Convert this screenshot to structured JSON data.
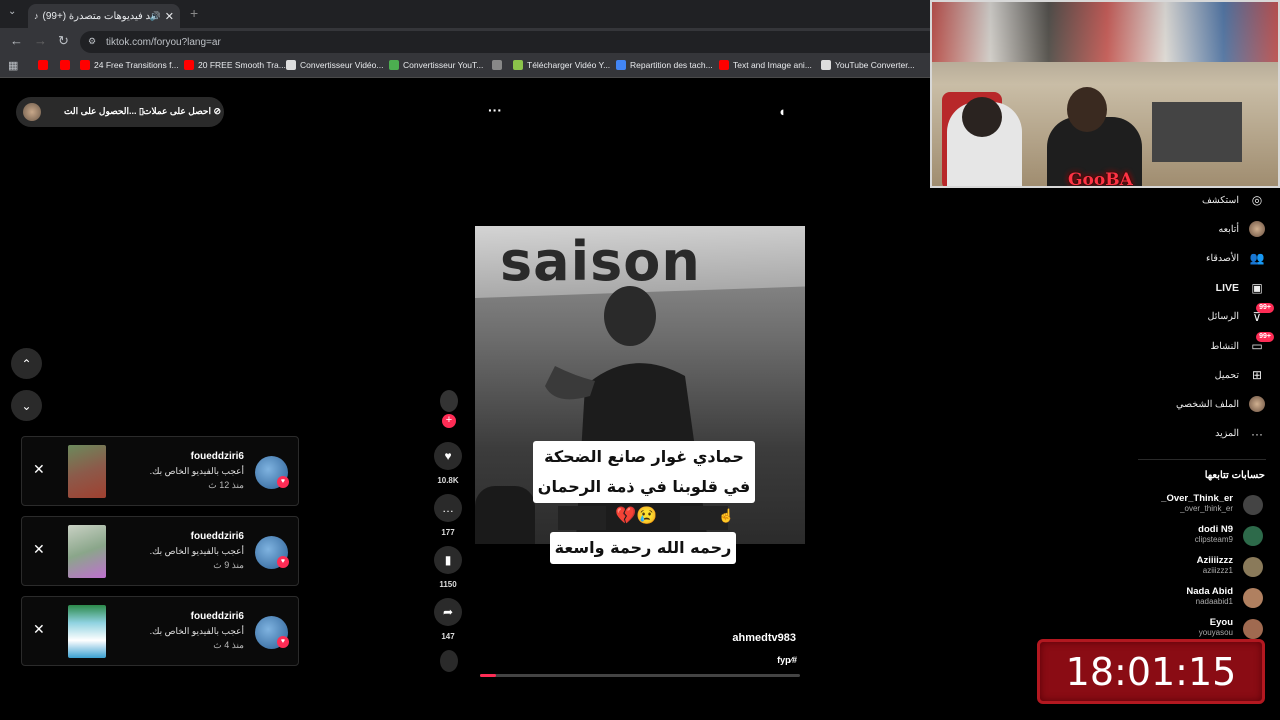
{
  "browser": {
    "tab_title": "(99+) شاهد فيديوهات متصدرة",
    "url": "tiktok.com/foryou?lang=ar",
    "bookmarks": [
      {
        "label": "",
        "color": "#ff0000"
      },
      {
        "label": "",
        "color": "#ff0000"
      },
      {
        "label": "24 Free Transitions f...",
        "color": "#ff0000"
      },
      {
        "label": "20 FREE Smooth Tra...",
        "color": "#ff0000"
      },
      {
        "label": "Convertisseur Vidéo...",
        "color": "#dddddd"
      },
      {
        "label": "Convertisseur YouT...",
        "color": "#4caf50"
      },
      {
        "label": "",
        "color": "#888888"
      },
      {
        "label": "Télécharger Vidéo Y...",
        "color": "#8bc34a"
      },
      {
        "label": "Repartition des tach...",
        "color": "#4285f4"
      },
      {
        "label": "Text and Image ani...",
        "color": "#ff0000"
      },
      {
        "label": "YouTube Converter...",
        "color": "#dddddd"
      }
    ]
  },
  "top": {
    "coins_label": "احصل على عملات",
    "app_label": "الحصول على الت...",
    "more_label": "···"
  },
  "notifications": [
    {
      "user": "foueddziri6",
      "message": "أعجب بالفيديو الخاص بك.",
      "time": "منذ 12 ث"
    },
    {
      "user": "foueddziri6",
      "message": "أعجب بالفيديو الخاص بك.",
      "time": "منذ 9 ث"
    },
    {
      "user": "foueddziri6",
      "message": "أعجب بالفيديو الخاص بك.",
      "time": "منذ 4 ث"
    }
  ],
  "video": {
    "banner_text": "saison",
    "caption_line1": "حمادي غوار صانع الضحكة",
    "caption_line2": "في قلوبنا في ذمة الرحمان",
    "caption_emoji": "💔😢",
    "caption_line3": "رحمه الله رحمة واسعة",
    "author": "ahmedtv983",
    "hashtag": "fyp#",
    "progress": 0.05
  },
  "actions": {
    "likes": "10.8K",
    "comments": "177",
    "saves": "1150",
    "shares": "147"
  },
  "nav": {
    "items": [
      {
        "label": "استكشف",
        "icon": "compass-icon"
      },
      {
        "label": "أتابعه",
        "icon": "avatar-icon"
      },
      {
        "label": "الأصدقاء",
        "icon": "friends-icon"
      },
      {
        "label": "LIVE",
        "icon": "live-icon"
      },
      {
        "label": "الرسائل",
        "icon": "messages-icon",
        "badge": "99+"
      },
      {
        "label": "النشاط",
        "icon": "activity-icon",
        "badge": "99+"
      },
      {
        "label": "تحميل",
        "icon": "upload-icon"
      },
      {
        "label": "الملف الشخصي",
        "icon": "profile-icon"
      },
      {
        "label": "المزيد",
        "icon": "more-icon"
      }
    ],
    "following_title": "حسابات تتابعها"
  },
  "following": [
    {
      "name": "_Over_Think_er",
      "handle": "_over_think_er"
    },
    {
      "name": "dodi N9",
      "handle": "clipsteam9"
    },
    {
      "name": "Aziiiizzz",
      "handle": "aziiizzz1"
    },
    {
      "name": "Nada Abid",
      "handle": "nadaabid1"
    },
    {
      "name": "Eyou",
      "handle": "youyasou"
    }
  ],
  "webcam": {
    "overlay_text": "GooBA"
  },
  "clock": {
    "time": "18:01:15"
  }
}
